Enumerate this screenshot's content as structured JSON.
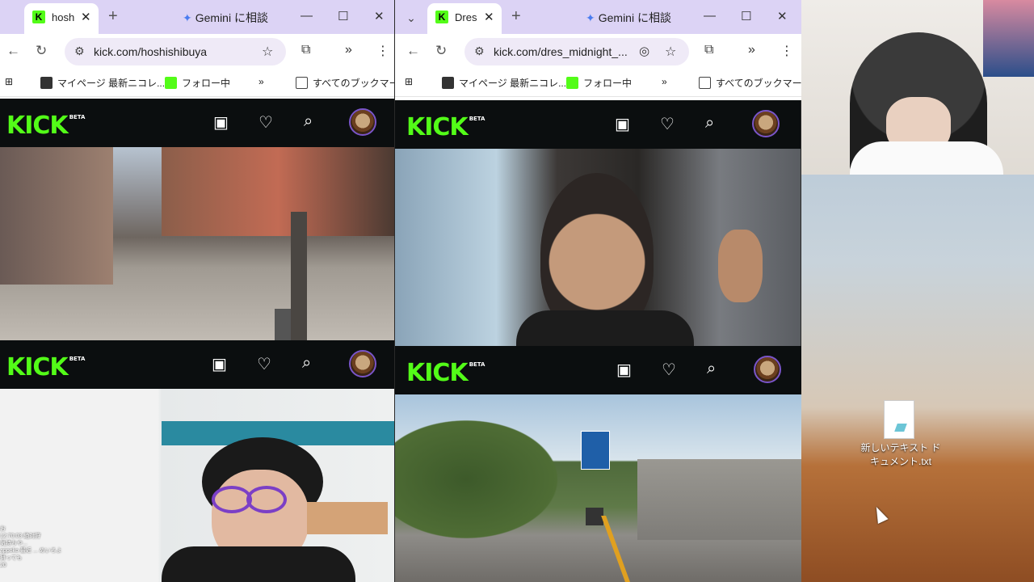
{
  "windows": [
    {
      "tab_title": "hosh",
      "gemini_label": "Gemini に相談",
      "url": "kick.com/hoshishibuya"
    },
    {
      "tab_title": "Dres",
      "gemini_label": "Gemini に相談",
      "url": "kick.com/dres_midnight_..."
    }
  ],
  "bookmarks": {
    "item1": "マイページ 最新ニコレ...",
    "item2": "フォロー中",
    "all": "すべてのブックマーク"
  },
  "kick": {
    "logo": "KICK",
    "beta": "BETA"
  },
  "desktop": {
    "file_label": "新しいテキスト ドキュメント.txt"
  },
  "chat_lines": [
    "お",
    "12:70:03 絶対狩",
    "気持ちや...",
    "appoko 最近 ... めいろよ",
    "舞っても",
    "20"
  ],
  "colors": {
    "kick_green": "#53fc18",
    "tab_strip": "#dcd3f5",
    "kick_header": "#0b0e0f"
  }
}
